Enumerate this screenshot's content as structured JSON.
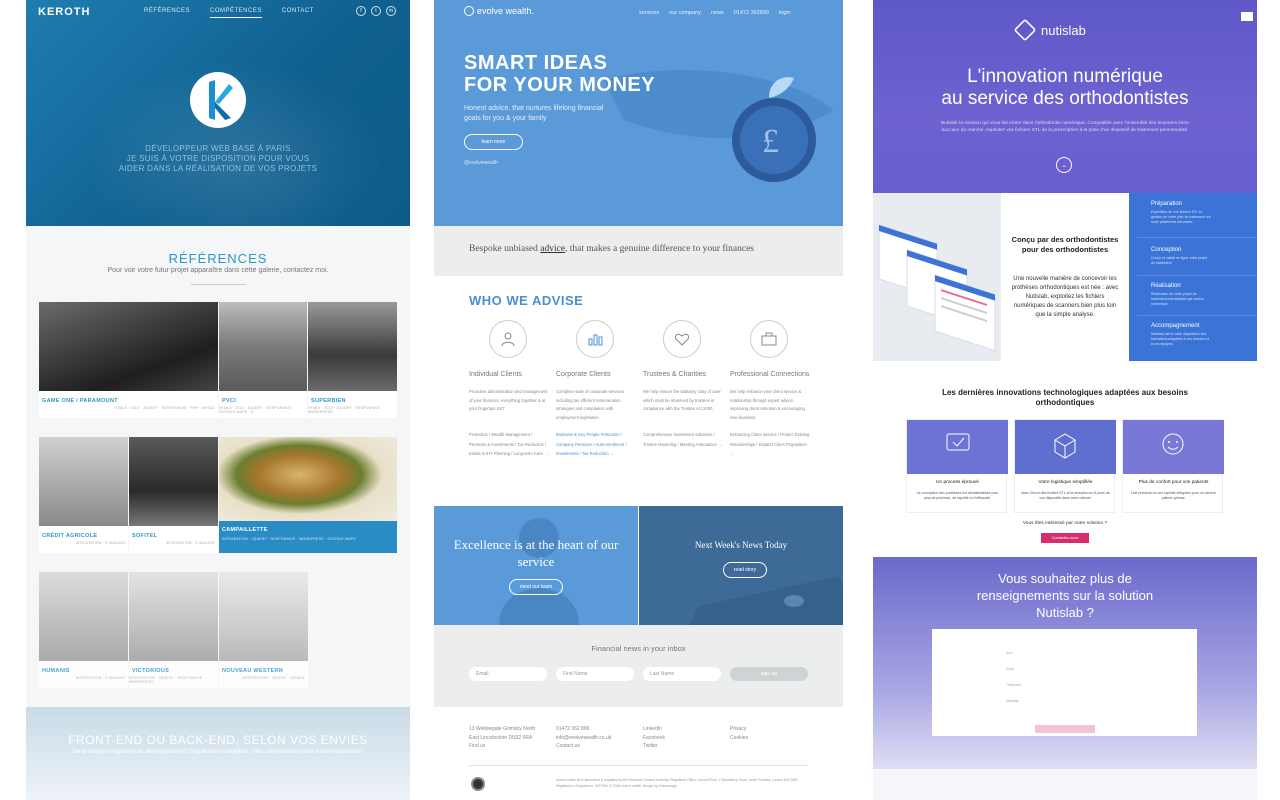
{
  "keroth": {
    "logo": "KEROTH",
    "nav": [
      "RÉFÉRENCES",
      "COMPÉTENCES",
      "CONTACT"
    ],
    "social": [
      "f",
      "t",
      "m"
    ],
    "tagline": [
      "DÉVELOPPEUR WEB BASÉ À PARIS",
      "JE SUIS À VOTRE DISPOSITION POUR VOUS",
      "AIDER DANS LA RÉALISATION DE VOS PROJETS"
    ],
    "references_title": "RÉFÉRENCES",
    "references_sub": "Pour voir votre futur projet apparaître dans cette galerie, contactez moi.",
    "tiles": [
      {
        "caption": "GAME ONE / PARAMOUNT",
        "meta": "HTML5 · 2013 · JQUERY · RESPONSIVE · PHP · MYSQL"
      },
      {
        "caption": "PVCI",
        "meta": "HTML5 · 2013 · JQUERY · RESPONSIVE · GOOGLE MAPS · S"
      },
      {
        "caption": "SUPERBIEN",
        "meta": "HTML5 · 2013 · JQUERY · RESPONSIVE · WORDPRESS"
      },
      {
        "caption": "CRÉDIT AGRICOLE",
        "meta": "INTÉGRATION · E-MAILING"
      },
      {
        "caption": "SOFITEL",
        "meta": "INTÉGRATION · E-MAILING"
      },
      {
        "caption": "CAMPAILLETTE",
        "meta": "INTÉGRATION · JQUERY · RESPONSIVE · WORDPRESS · GOOGLE MAPS"
      },
      {
        "caption": "HUMANIS",
        "meta": "INTÉGRATION · E-MAILING"
      },
      {
        "caption": "VICTORIOUS",
        "meta": "INTÉGRATION · JQUERY · RESPONSIVE · WORDPRESS"
      },
      {
        "caption": "NOUVEAU WESTERN",
        "meta": "INTÉGRATION · JQUERY · MOBILE"
      }
    ],
    "bottom_title": "FRONT-END OU BACK-END, SELON VOS ENVIES",
    "bottom_sub": "De la simple intégration au développement d'application complexe, mes compétences sont à votre disposition"
  },
  "evolve": {
    "logo": "evolve wealth.",
    "nav": [
      "services",
      "our company",
      "news",
      "01472 362899",
      "login"
    ],
    "hero_title": [
      "SMART IDEAS",
      "FOR YOUR MONEY"
    ],
    "hero_text": "Honest advice, that nurtures lifelong financial goals for you & your family",
    "hero_button": "learn more",
    "twitter": "@evolvewealth",
    "bespoke_pre": "Bespoke unbiased ",
    "bespoke_link": "advice",
    "bespoke_post": ", that makes a genuine difference to your finances",
    "who_title": "WHO WE ADVISE",
    "clients": [
      {
        "title": "Individual Clients",
        "desc": "Proactive administration and management of your finances, everything together & at your fingertips 24/7.",
        "links": "Protection / Wealth Management / Pensions & Investments / Tax Reduction / Estate & IHT Planning / Long-term Care →",
        "blue": false
      },
      {
        "title": "Corporate Clients",
        "desc": "Complete suite of corporate services including tax efficient remuneration strategies and compliance with employment legislation.",
        "links": "Business & Key People Protection / Company Pensions / Auto-enrolment / Investments / Tax Reduction →",
        "blue": true
      },
      {
        "title": "Trustees & Charities",
        "desc": "We help ensure the statutory 'duty of care' which must be observed by trustees in compliance with the Trustee Act 2000.",
        "links": "Comprehensive Investment Solutions / Trustee Reporting / Meeting Attendance →",
        "blue": false
      },
      {
        "title": "Professional Connections",
        "desc": "We help enhance your client service & relationship through expert advice, improving client retention & encouraging new business.",
        "links": "Enhancing Client Service / Protect Existing Relationships / Expand Client Proposition →",
        "blue": false
      }
    ],
    "panel1_title": "Excellence is at the heart of our service",
    "panel1_button": "meet our team",
    "panel2_title": "Next Week's News Today",
    "panel2_button": "read story",
    "news_title": "Financial news in your inbox",
    "fields": [
      "Email",
      "First Name",
      "Last Name"
    ],
    "signup": "sign up",
    "footer_cols": [
      [
        "13 Wellowgate Grimsby North",
        "East Lincolnshire DN32 0RA",
        "Find us"
      ],
      [
        "01472 362 899",
        "info@evolvewealth.co.uk",
        "Contact us"
      ],
      [
        "LinkedIn",
        "Facebook",
        "Twitter"
      ],
      [
        "Privacy",
        "Cookies"
      ]
    ],
    "legal": "evolve wealth ltd is authorised & regulated by the Financial Conduct Authority. Registered Office: Ground Floor, 2 Woodberry Grove, North Finchley, London N12 0DR. Registered in England no. 9127094. © 2016 evolve wealth. Design by Uniondesign"
  },
  "nutislab": {
    "logo": "nutislab",
    "hero_title": [
      "L'innovation numérique",
      "au service des orthodontistes"
    ],
    "hero_text": "Nutislab la solution qui vous fait entrer dans l'orthodontie numérique. Compatible avec l'ensemble des scanners intra-buccaux du marché, exploitez vos fichiers STL de la prescription à la pose d'un dispositif de traitement personnalisé.",
    "feature_title": "Conçu par des orthodontistes pour des orthodontistes",
    "feature_text": "Une nouvelle manière de concevoir les prothèses orthodontiques est née : avec Nutislab, exploitez les fichiers numériques de scanners bien plus loin que la simple analyse.",
    "side_items": [
      {
        "title": "Préparation",
        "text": "Expédition de vos fichiers STL et gestion de votre plan de traitement sur notre plateforme sécurisée."
      },
      {
        "title": "Conception",
        "text": "Conçu et validé en ligne votre projet de traitement."
      },
      {
        "title": "Réalisation",
        "text": "Réalisation de votre projet de traitement individualisé par chaîne numérique."
      },
      {
        "title": "Accompagnement",
        "text": "Nutislab met à votre disposition des formations adaptées à vos besoins et à vos équipes."
      }
    ],
    "innov_title": "Les dernières innovations technologiques adaptées aux besoins orthodontiques",
    "cards": [
      {
        "title": "Un process éprouvé",
        "text": "La conception des prothèses est dématérialisée pour plus de précision, de rapidité et d'efficacité."
      },
      {
        "title": "Votre logistique simplifiée",
        "text": "Avec l'envoi des fichiers STL et la réception en 5 jours de vos dispositifs dans votre cabinet."
      },
      {
        "title": "Plus de confort pour vos patients",
        "text": "Une précision et une rapidité intégrées pour un service patient optimal."
      }
    ],
    "question": "Vous êtes intéressé par notre solution ?",
    "contact_button": "Contactez-nous",
    "form_title": [
      "Vous souhaitez plus de",
      "renseignements sur la solution",
      "Nutislab ?"
    ],
    "form_labels": [
      "Nom",
      "Email",
      "Téléphone",
      "Message"
    ]
  },
  "colors": {
    "keroth_blue": "#0f5f8f",
    "evolve_blue": "#5b9ad8",
    "nutislab_purple": "#6a5fcf",
    "nutislab_side": "#3b73d6",
    "nutislab_cta": "#d82d6b"
  }
}
